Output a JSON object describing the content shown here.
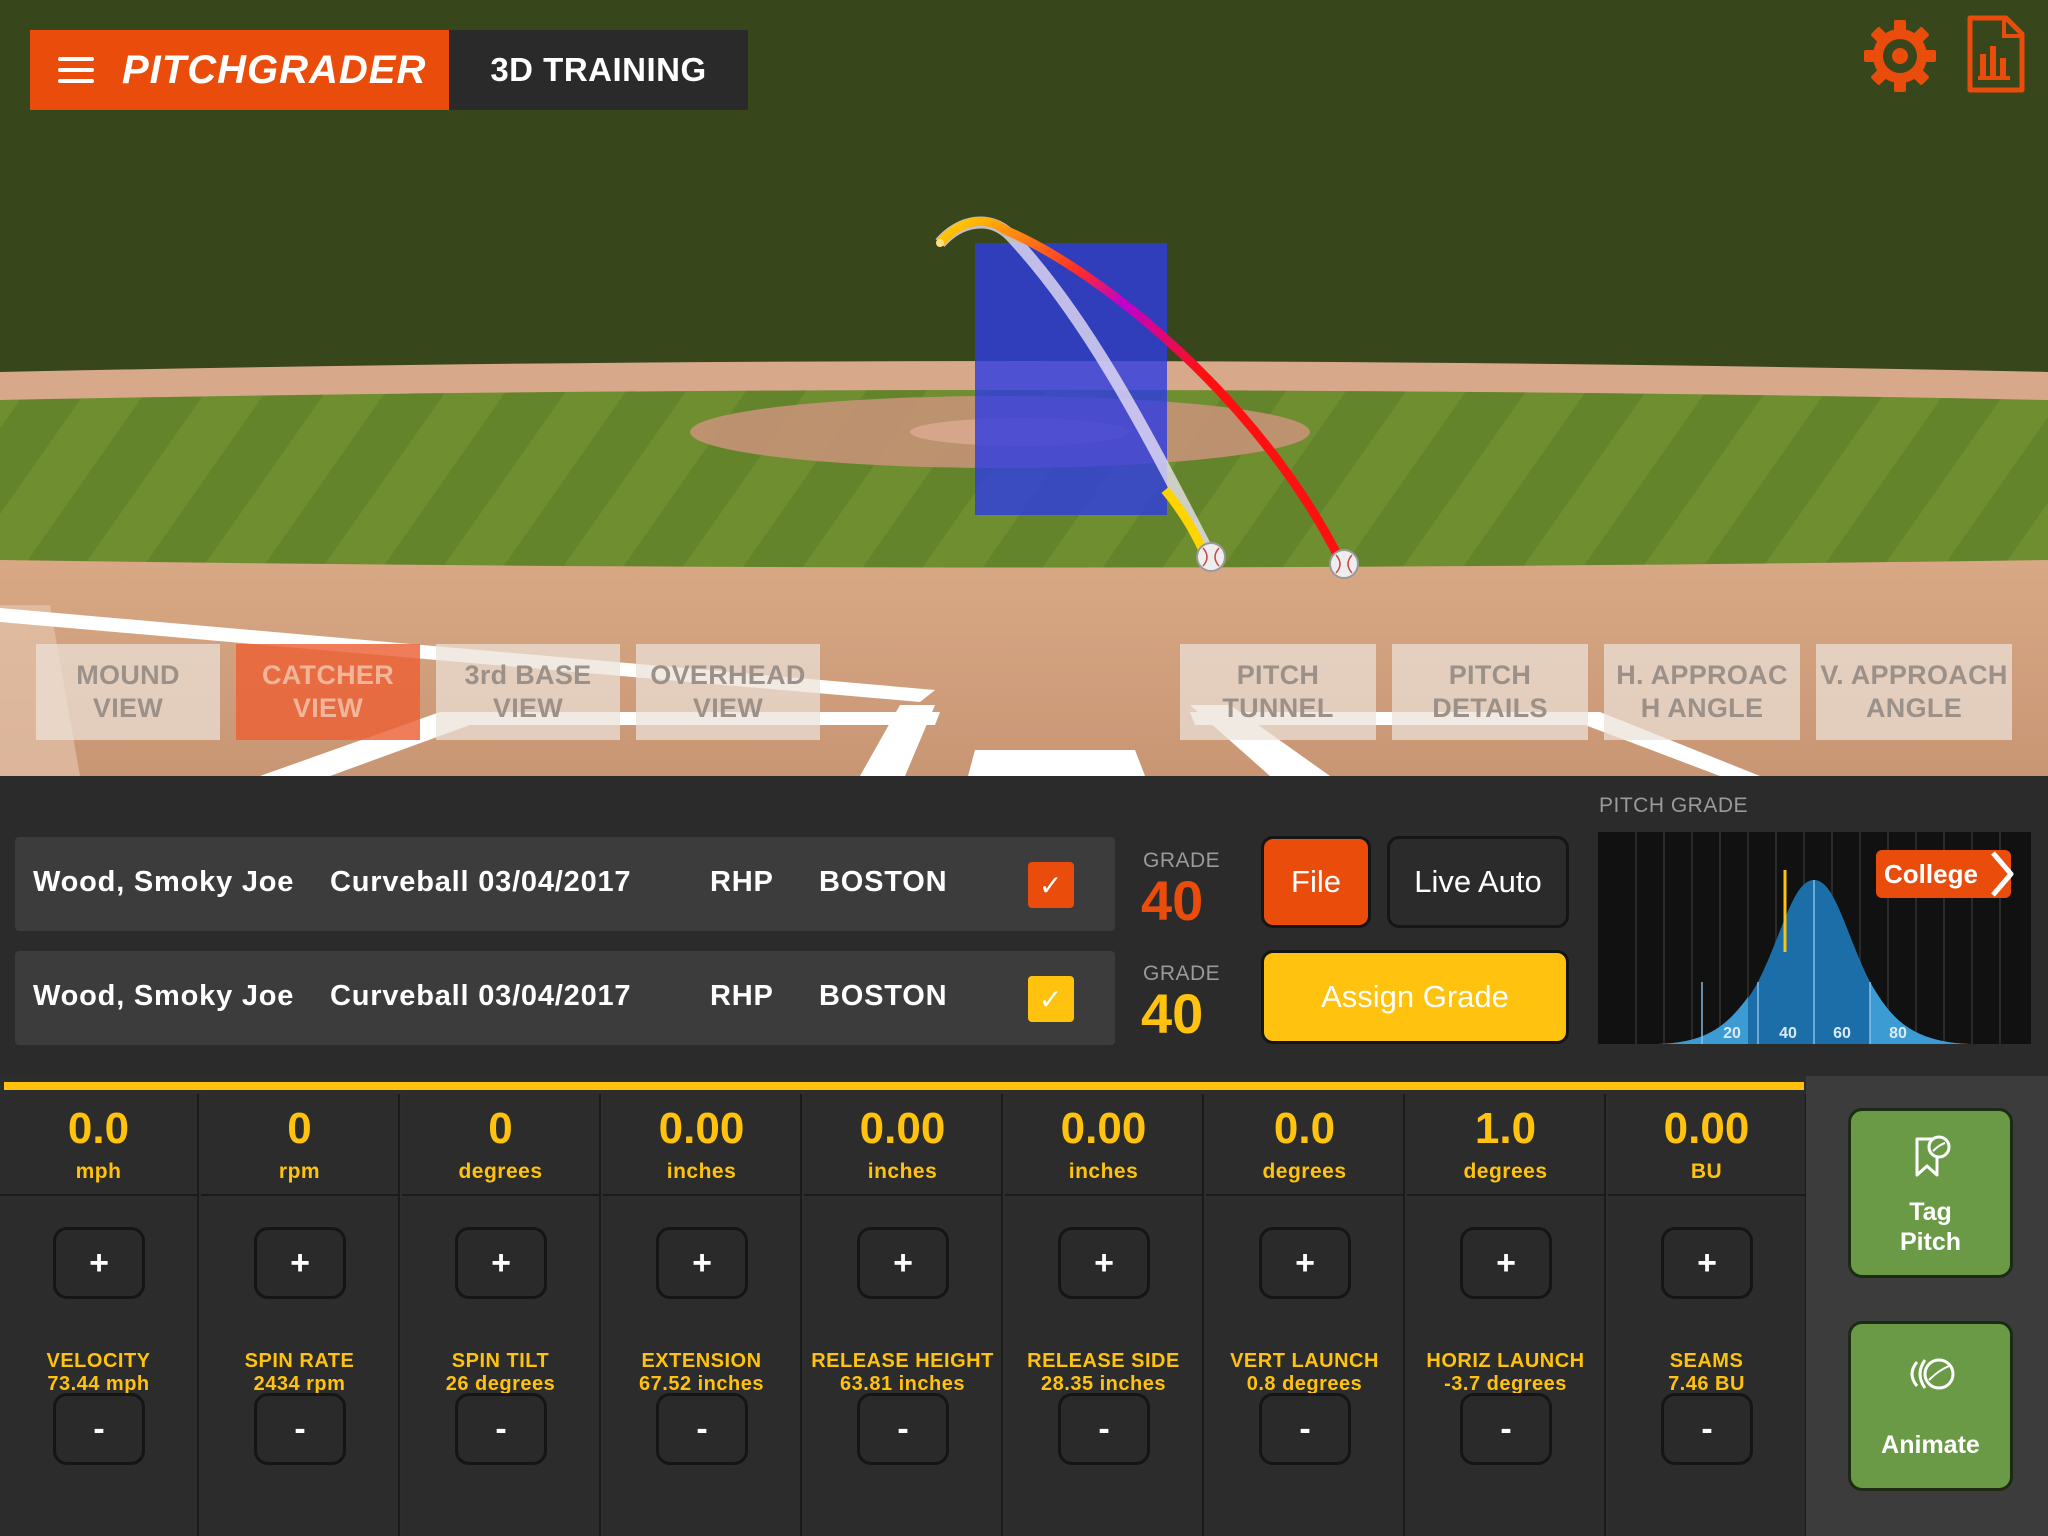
{
  "app": {
    "brand": "PITCHGRADER",
    "title": "3D TRAINING"
  },
  "top_icons": [
    "settings-gear-icon",
    "report-document-icon"
  ],
  "views": [
    {
      "id": "mound",
      "line1": "MOUND",
      "line2": "VIEW",
      "active": false
    },
    {
      "id": "catcher",
      "line1": "CATCHER",
      "line2": "VIEW",
      "active": true
    },
    {
      "id": "third-base",
      "line1": "3rd BASE",
      "line2": "VIEW",
      "active": false
    },
    {
      "id": "overhead",
      "line1": "OVERHEAD",
      "line2": "VIEW",
      "active": false
    }
  ],
  "analysis": [
    {
      "id": "pitch-tunnel",
      "line1": "PITCH",
      "line2": "TUNNEL"
    },
    {
      "id": "pitch-details",
      "line1": "PITCH",
      "line2": "DETAILS"
    },
    {
      "id": "h-approach",
      "line1": "H. APPROAC",
      "line2": "H ANGLE"
    },
    {
      "id": "v-approach",
      "line1": "V. APPROACH",
      "line2": "ANGLE"
    }
  ],
  "pitches": [
    {
      "player": "Wood, Smoky Joe",
      "pitch": "Curveball 03/04/2017",
      "hand": "RHP",
      "team": "BOSTON",
      "checked": true,
      "check_color": "#ea4c0c",
      "grade_label": "GRADE",
      "grade": "40",
      "grade_color": "#ea4c0c"
    },
    {
      "player": "Wood, Smoky Joe",
      "pitch": "Curveball 03/04/2017",
      "hand": "RHP",
      "team": "BOSTON",
      "checked": true,
      "check_color": "#ffc20e",
      "grade_label": "GRADE",
      "grade": "40",
      "grade_color": "#ffc20e"
    }
  ],
  "buttons": {
    "file": "File",
    "live_auto": "Live Auto",
    "assign_grade": "Assign Grade",
    "tag_pitch_1": "Tag",
    "tag_pitch_2": "Pitch",
    "animate": "Animate"
  },
  "pitch_grade": {
    "label": "PITCH GRADE",
    "level": "College",
    "ticks": [
      "20",
      "40",
      "60",
      "80"
    ],
    "marker_grade": 40
  },
  "metrics": [
    {
      "value": "0.0",
      "unit": "mph",
      "name": "VELOCITY",
      "current": "73.44 mph"
    },
    {
      "value": "0",
      "unit": "rpm",
      "name": "SPIN RATE",
      "current": "2434 rpm"
    },
    {
      "value": "0",
      "unit": "degrees",
      "name": "SPIN TILT",
      "current": "26 degrees"
    },
    {
      "value": "0.00",
      "unit": "inches",
      "name": "EXTENSION",
      "current": "67.52 inches"
    },
    {
      "value": "0.00",
      "unit": "inches",
      "name": "RELEASE HEIGHT",
      "current": "63.81 inches"
    },
    {
      "value": "0.00",
      "unit": "inches",
      "name": "RELEASE SIDE",
      "current": "28.35 inches"
    },
    {
      "value": "0.0",
      "unit": "degrees",
      "name": "VERT LAUNCH",
      "current": "0.8 degrees"
    },
    {
      "value": "1.0",
      "unit": "degrees",
      "name": "HORIZ LAUNCH",
      "current": "-3.7 degrees"
    },
    {
      "value": "0.00",
      "unit": "BU",
      "name": "SEAMS",
      "current": "7.46 BU"
    }
  ],
  "stepper": {
    "plus": "+",
    "minus": "-"
  },
  "colors": {
    "accent": "#ea4c0c",
    "yellow": "#ffc20e",
    "green": "#6b9a47",
    "zone": "#2f3de0"
  }
}
